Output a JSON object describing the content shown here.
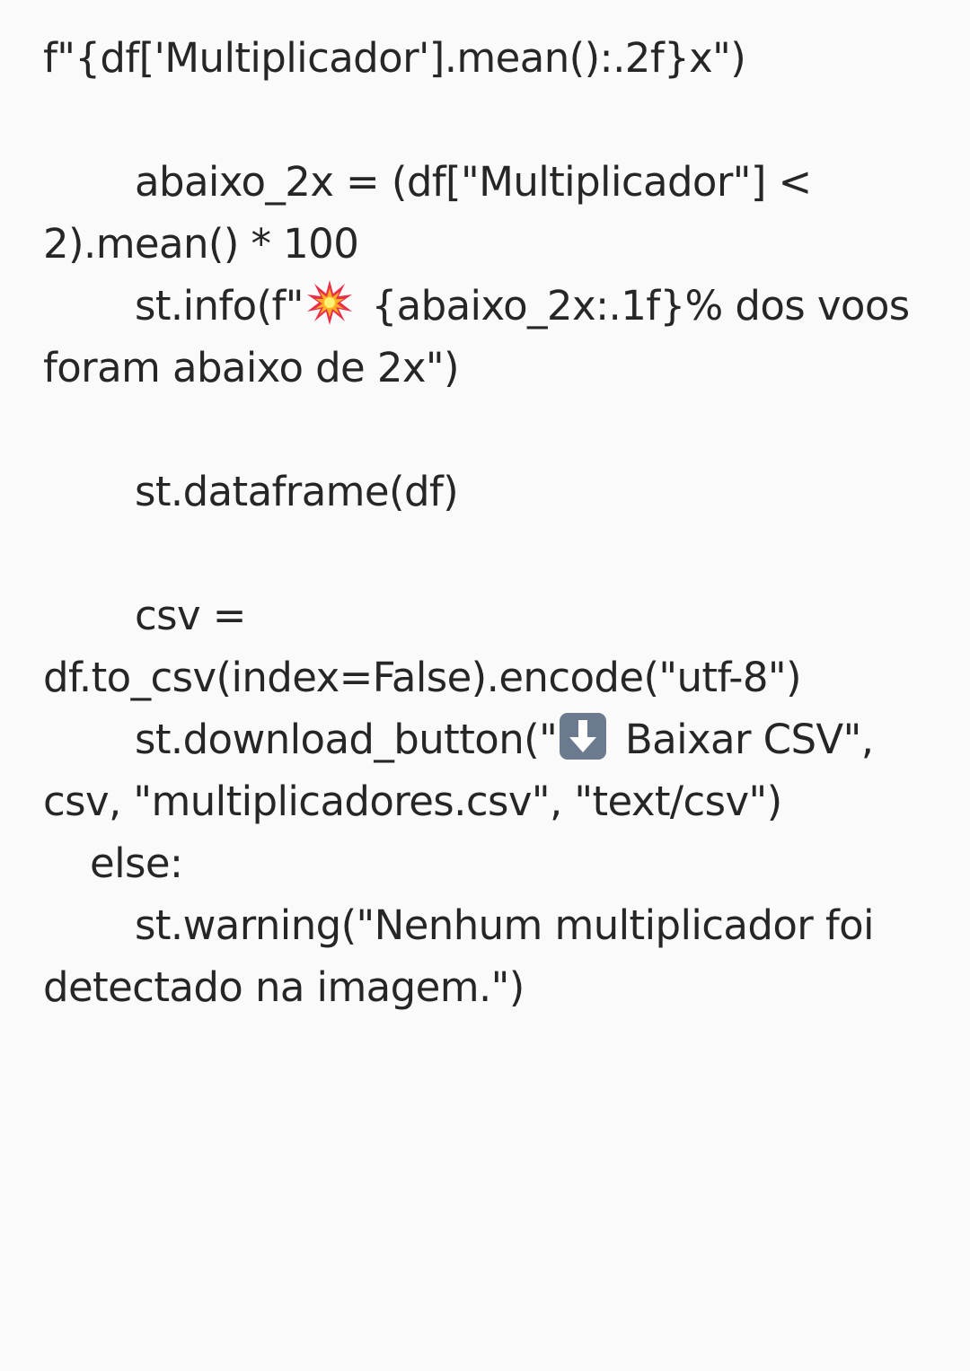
{
  "document": {
    "lines": [
      "f\"{df['Multiplicador'].mean():.2f}x\")",
      "",
      "abaixo_2x = (df[\"Multiplicador\"] <",
      "2).mean() * 100",
      [
        "st.info(f\"",
        " {abaixo_2x:.1f}% dos voos"
      ],
      "foram abaixo de 2x\")",
      "",
      "st.dataframe(df)",
      "",
      "csv =",
      "df.to_csv(index=False).encode(\"utf-8\")",
      [
        "st.download_button(\"",
        " Baixar CSV\","
      ],
      "csv, \"multiplicadores.csv\", \"text/csv\")",
      "else:",
      "st.warning(\"Nenhum multiplicador foi",
      "detectado na imagem.\")"
    ]
  },
  "icons": {
    "collision": "collision-emoji-icon",
    "down_arrow": "down-arrow-emoji-icon"
  },
  "colors": {
    "background": "#fafafa",
    "text": "#262626",
    "arrow_key_bg": "#6b7a8f"
  }
}
